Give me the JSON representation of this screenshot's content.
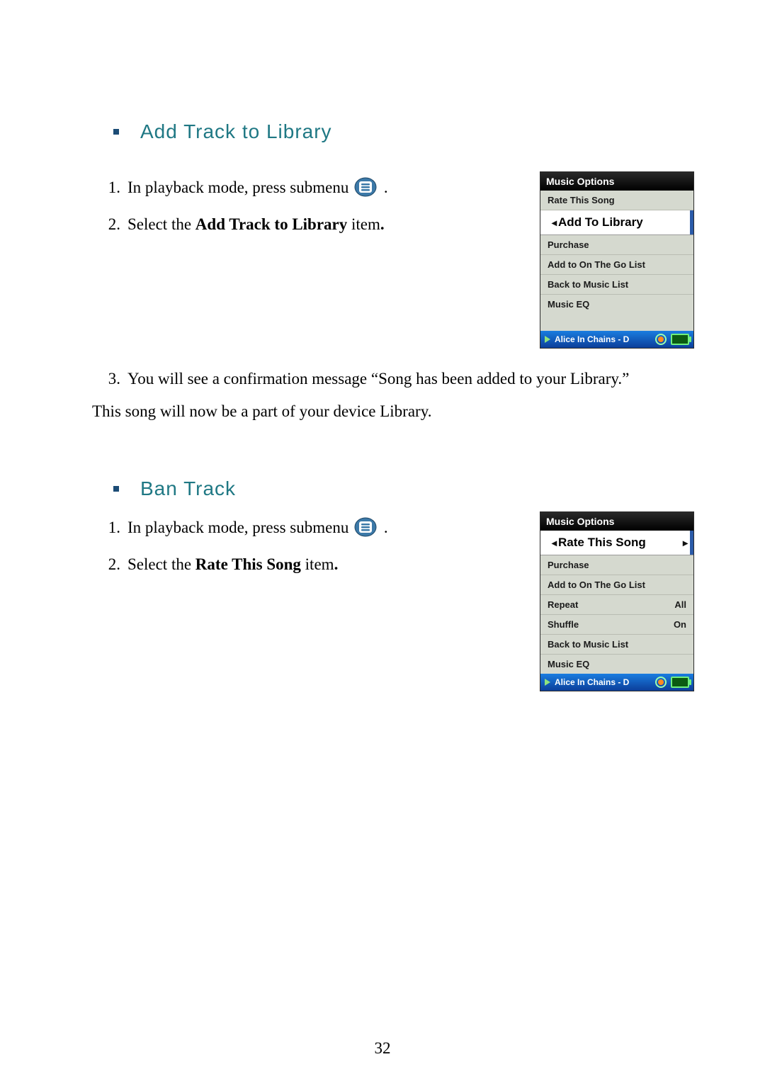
{
  "pageNumber": "32",
  "section1": {
    "title": "Add Track to Library",
    "step1_a": "In playback mode, press submenu ",
    "step1_b": " .",
    "step2_a": "Select the ",
    "step2_bold": "Add Track to Library",
    "step2_b": " item",
    "step2_c": ".",
    "step3": "You will see a confirmation message “Song has been added to your Library.”",
    "followup": "This song will now be a part of your device Library."
  },
  "section2": {
    "title": "Ban Track",
    "step1_a": "In playback mode, press submenu ",
    "step1_b": " .",
    "step2_a": "Select the ",
    "step2_bold": "Rate This Song",
    "step2_b": " item",
    "step2_c": "."
  },
  "device1": {
    "header": "Music Options",
    "items": {
      "rate": "Rate This Song",
      "addlib": "Add To Library",
      "purchase": "Purchase",
      "ongo": "Add to On The Go List",
      "back": "Back to Music List",
      "eq": "Music EQ"
    },
    "nowplaying": "Alice In Chains - D"
  },
  "device2": {
    "header": "Music Options",
    "items": {
      "rate": "Rate This Song",
      "purchase": "Purchase",
      "ongo": "Add to On The Go List",
      "repeat": {
        "label": "Repeat",
        "value": "All"
      },
      "shuffle": {
        "label": "Shuffle",
        "value": "On"
      },
      "back": "Back to Music List",
      "eq": "Music EQ"
    },
    "nowplaying": "Alice In Chains - D"
  }
}
